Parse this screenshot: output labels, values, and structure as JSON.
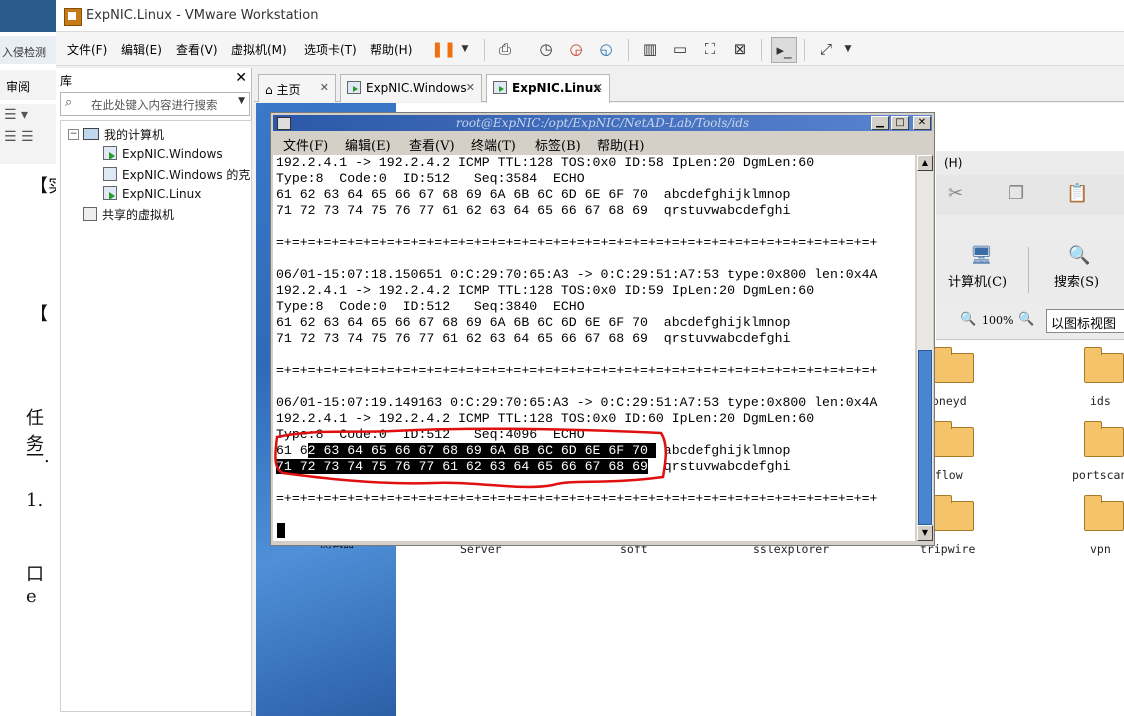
{
  "background_doc": {
    "toolbar_text": "入侵检测",
    "review_tab": "审阅",
    "glyphs": [
      "【实",
      "【",
      "任务",
      "一.",
      "1.",
      "口 e"
    ]
  },
  "window": {
    "title": "ExpNIC.Linux - VMware Workstation"
  },
  "menu": [
    "文件(F)",
    "编辑(E)",
    "查看(V)",
    "虚拟机(M)",
    "选项卡(T)",
    "帮助(H)"
  ],
  "library": {
    "title": "库",
    "search_placeholder": "在此处键入内容进行搜索",
    "tree": {
      "root": "我的计算机",
      "items": [
        "ExpNIC.Windows",
        "ExpNIC.Windows 的克",
        "ExpNIC.Linux"
      ],
      "shared": "共享的虚拟机"
    }
  },
  "tabs": [
    {
      "label": "主页",
      "active": false
    },
    {
      "label": "ExpNIC.Windows",
      "active": false
    },
    {
      "label": "ExpNIC.Linux",
      "active": true
    }
  ],
  "terminal": {
    "title": "root@ExpNIC:/opt/ExpNIC/NetAD-Lab/Tools/ids",
    "menu": [
      "文件(F)",
      "编辑(E)",
      "查看(V)",
      "终端(T)",
      "标签(B)",
      "帮助(H)"
    ],
    "lines": [
      "192.2.4.1 -> 192.2.4.2 ICMP TTL:128 TOS:0x0 ID:58 IpLen:20 DgmLen:60",
      "Type:8  Code:0  ID:512   Seq:3584  ECHO",
      "61 62 63 64 65 66 67 68 69 6A 6B 6C 6D 6E 6F 70  abcdefghijklmnop",
      "71 72 73 74 75 76 77 61 62 63 64 65 66 67 68 69  qrstuvwabcdefghi",
      "",
      "=+=+=+=+=+=+=+=+=+=+=+=+=+=+=+=+=+=+=+=+=+=+=+=+=+=+=+=+=+=+=+=+=+=+=+=+=+=+",
      "",
      "06/01-15:07:18.150651 0:C:29:70:65:A3 -> 0:C:29:51:A7:53 type:0x800 len:0x4A",
      "192.2.4.1 -> 192.2.4.2 ICMP TTL:128 TOS:0x0 ID:59 IpLen:20 DgmLen:60",
      "Type:8  Code:0  ID:512   Seq:3840  ECHO",
      "61 62 63 64 65 66 67 68 69 6A 6B 6C 6D 6E 6F 70  abcdefghijklmnop",
      "71 72 73 74 75 76 77 61 62 63 64 65 66 67 68 69  qrstuvwabcdefghi",
      "",
      "=+=+=+=+=+=+=+=+=+=+=+=+=+=+=+=+=+=+=+=+=+=+=+=+=+=+=+=+=+=+=+=+=+=+=+=+=+=+",
      "",
      "06/01-15:07:19.149163 0:C:29:70:65:A3 -> 0:C:29:51:A7:53 type:0x800 len:0x4A",
      "192.2.4.1 -> 192.2.4.2 ICMP TTL:128 TOS:0x0 ID:60 IpLen:20 DgmLen:60",
      "Type:8  Code:0  ID:512   Seq:4096  ECHO"
    ],
    "hl_line_a_pre": "61 6",
    "hl_line_a_sel": "2 63 64 65 66 67 68 69 6A 6B 6C 6D 6E 6F 70 ",
    "hl_line_a_post": " abcdefghijklmnop",
    "hl_line_b_pre": "",
    "hl_line_b_sel": "71 72 73 74 75 76 77 61 62 63 64 65 66 67 68 69",
    "hl_line_b_post": "  qrstuvwabcdefghi",
    "sep_last": "=+=+=+=+=+=+=+=+=+=+=+=+=+=+=+=+=+=+=+=+=+=+=+=+=+=+=+=+=+=+=+=+=+=+=+=+=+=+"
  },
  "file_manager": {
    "menu_fragment": "(H)",
    "computer_label": "计算机(C)",
    "search_label": "搜索(S)",
    "zoom": "100%",
    "view_mode": "以图标视图",
    "folders": [
      "oneyd",
      "ids",
      "rflow",
      "portscan",
      "Server",
      "soft",
      "sslexplorer",
      "tripwire",
      "vpn",
      "测试器"
    ]
  }
}
